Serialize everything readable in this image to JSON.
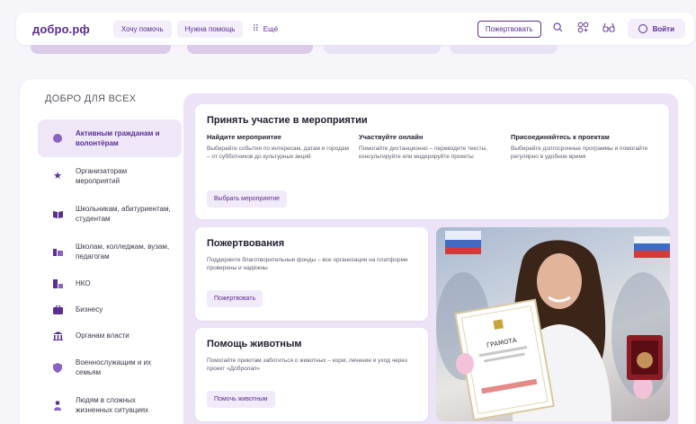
{
  "header": {
    "logo": "добро.рф",
    "nav": [
      "Хочу помочь",
      "Нужна помощь"
    ],
    "more_label": "Ещё",
    "donate_label": "Пожертвовать",
    "login_label": "Войти"
  },
  "section_title": "ДОБРО ДЛЯ ВСЕХ",
  "sidebar": {
    "items": [
      {
        "label": "Активным гражданам и волонтёрам",
        "icon": "circle-icon"
      },
      {
        "label": "Организаторам мероприятий",
        "icon": "star-icon"
      },
      {
        "label": "Школьникам, абитуриентам, студентам",
        "icon": "book-icon"
      },
      {
        "label": "Школам, колледжам, вузам, педагогам",
        "icon": "school-icon"
      },
      {
        "label": "НКО",
        "icon": "org-icon"
      },
      {
        "label": "Бизнесу",
        "icon": "briefcase-icon"
      },
      {
        "label": "Органам власти",
        "icon": "government-icon"
      },
      {
        "label": "Военнослужащим и их семьям",
        "icon": "shield-icon"
      },
      {
        "label": "Людям в сложных жизненных ситуациях",
        "icon": "person-icon"
      }
    ]
  },
  "events_card": {
    "title": "Принять участие в мероприятии",
    "columns": [
      {
        "title": "Найдите мероприятие",
        "text": "Выбирайте события по интересам, датам и городам – от субботников до культурных акций"
      },
      {
        "title": "Участвуйте онлайн",
        "text": "Помогайте дистанционно – переводите тексты, консультируйте или модерируйте проекты"
      },
      {
        "title": "Присоединяйтесь к проектам",
        "text": "Выбирайте долгосрочные программы и помогайте регулярно в удобное время"
      }
    ],
    "button": "Выбрать мероприятие"
  },
  "donations_card": {
    "title": "Пожертвования",
    "text": "Поддержите благотворительные фонды – все организации на платформе проверены и надёжны",
    "button": "Пожертвовать"
  },
  "animals_card": {
    "title": "Помощь животным",
    "text": "Помогайте приютам заботиться о животных – корм, лечение и уход через проект «Добролап»",
    "button": "Помочь животным"
  },
  "photo": {
    "certificate_text": "ГРАМОТА"
  },
  "colors": {
    "brand": "#5b2e91",
    "panel": "#ece4f6",
    "chip": "#f3eef9"
  }
}
